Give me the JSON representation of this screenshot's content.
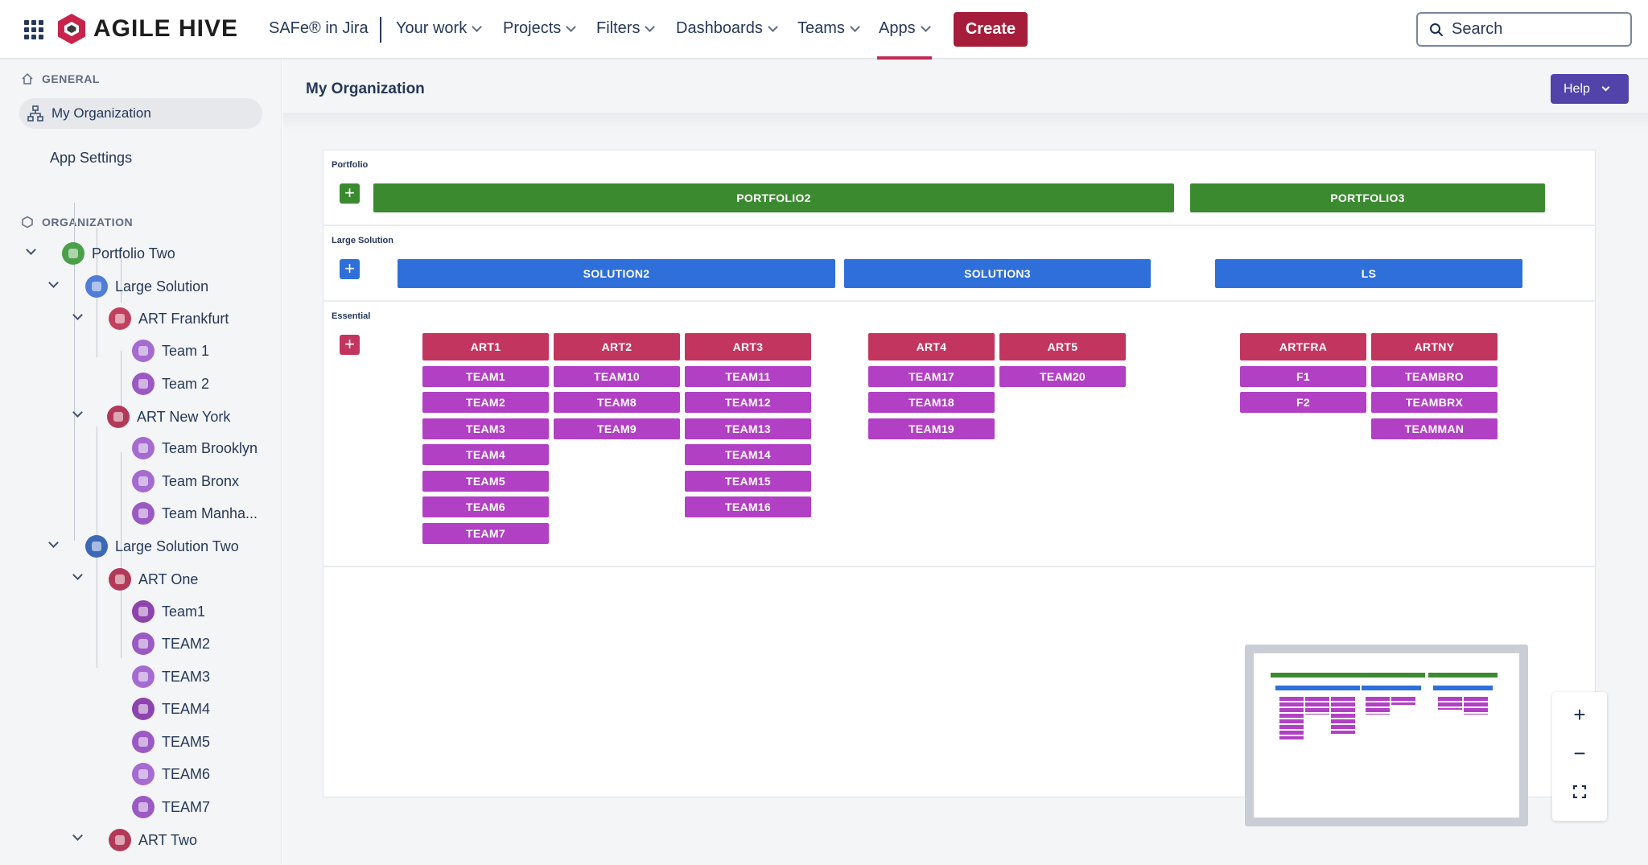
{
  "topnav": {
    "logo_text": "AGILE HIVE",
    "product": "SAFe® in Jira",
    "items": [
      {
        "label": "Your work"
      },
      {
        "label": "Projects"
      },
      {
        "label": "Filters"
      },
      {
        "label": "Dashboards"
      },
      {
        "label": "Teams"
      },
      {
        "label": "Apps"
      }
    ],
    "create_label": "Create",
    "search_placeholder": "Search"
  },
  "sidebar": {
    "general_heading": "GENERAL",
    "my_org_label": "My Organization",
    "app_settings_label": "App Settings",
    "organization_heading": "ORGANIZATION",
    "tree": [
      {
        "label": "Portfolio Two",
        "color": "#4a9f49"
      },
      {
        "label": "Large Solution",
        "color": "#4f7dd8"
      },
      {
        "label": "ART Frankfurt",
        "color": "#c0405e"
      },
      {
        "label": "Team 1",
        "color": "#a56bd0"
      },
      {
        "label": "Team 2",
        "color": "#9b59c4"
      },
      {
        "label": "ART New York",
        "color": "#b23a58"
      },
      {
        "label": "Team Brooklyn",
        "color": "#a56bd0"
      },
      {
        "label": "Team Bronx",
        "color": "#a56bd0"
      },
      {
        "label": "Team Manha...",
        "color": "#9b59c4"
      },
      {
        "label": "Large Solution Two",
        "color": "#3b69b8"
      },
      {
        "label": "ART One",
        "color": "#b23a58"
      },
      {
        "label": "Team1",
        "color": "#8e44ad"
      },
      {
        "label": "TEAM2",
        "color": "#9b59c4"
      },
      {
        "label": "TEAM3",
        "color": "#a56bd0"
      },
      {
        "label": "TEAM4",
        "color": "#8e44ad"
      },
      {
        "label": "TEAM5",
        "color": "#9b59c4"
      },
      {
        "label": "TEAM6",
        "color": "#a56bd0"
      },
      {
        "label": "TEAM7",
        "color": "#9b59c4"
      },
      {
        "label": "ART Two",
        "color": "#b23a58"
      }
    ]
  },
  "main": {
    "title": "My Organization",
    "help_label": "Help",
    "levels": {
      "portfolio_label": "Portfolio",
      "large_solution_label": "Large Solution",
      "essential_label": "Essential"
    },
    "portfolios": [
      "PORTFOLIO2",
      "PORTFOLIO3"
    ],
    "solutions": [
      "SOLUTION2",
      "SOLUTION3",
      "LS"
    ],
    "arts": [
      {
        "name": "ART1",
        "teams": [
          "TEAM1",
          "TEAM2",
          "TEAM3",
          "TEAM4",
          "TEAM5",
          "TEAM6",
          "TEAM7"
        ]
      },
      {
        "name": "ART2",
        "teams": [
          "TEAM10",
          "TEAM8",
          "TEAM9"
        ]
      },
      {
        "name": "ART3",
        "teams": [
          "TEAM11",
          "TEAM12",
          "TEAM13",
          "TEAM14",
          "TEAM15",
          "TEAM16"
        ]
      },
      {
        "name": "ART4",
        "teams": [
          "TEAM17",
          "TEAM18",
          "TEAM19"
        ]
      },
      {
        "name": "ART5",
        "teams": [
          "TEAM20"
        ]
      },
      {
        "name": "ARTFRA",
        "teams": [
          "F1",
          "F2"
        ]
      },
      {
        "name": "ARTNY",
        "teams": [
          "TEAMBRO",
          "TEAMBRX",
          "TEAMMAN"
        ]
      }
    ],
    "zoom": {
      "in": "+",
      "out": "−"
    }
  },
  "colors": {
    "portfolio": "#3b8a30",
    "solution": "#2e6fd9",
    "art": "#c2355f",
    "team": "#b240c4",
    "create": "#a51d3a",
    "help": "#5243aa"
  }
}
